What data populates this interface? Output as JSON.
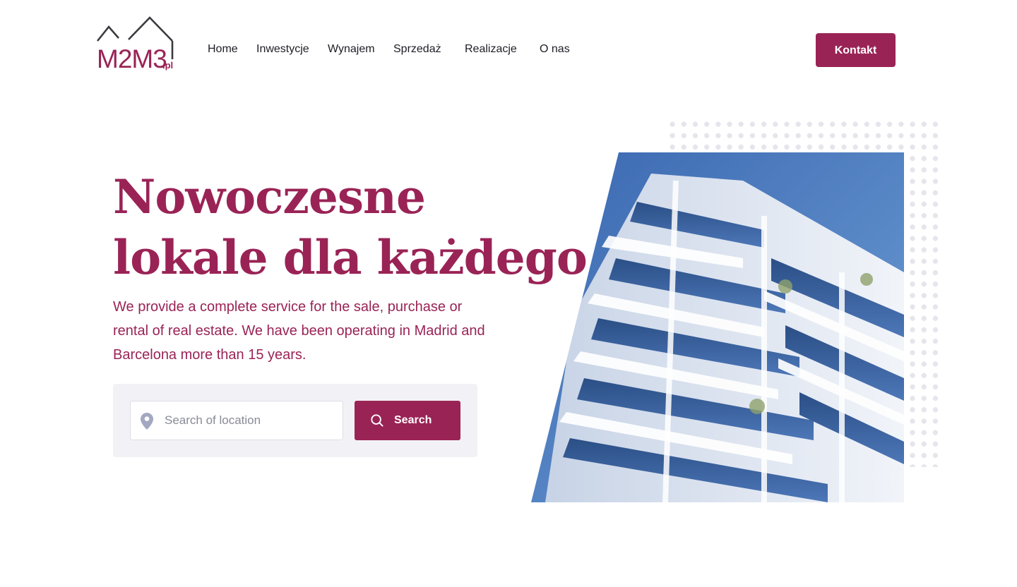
{
  "brand": {
    "logo_text": "M2M3",
    "logo_suffix": ".pl",
    "accent_color": "#9a2356"
  },
  "nav": {
    "items": [
      {
        "label": "Home"
      },
      {
        "label": "Inwestycje"
      },
      {
        "label": "Wynajem"
      },
      {
        "label": "Sprzedaż"
      },
      {
        "label": "Realizacje"
      },
      {
        "label": "O nas"
      }
    ],
    "contact_label": "Kontakt"
  },
  "hero": {
    "title_line1": "Nowoczesne",
    "title_line2": "lokale dla każdego",
    "description": "We provide a complete service for the sale, purchase or rental of real estate. We have been operating in Madrid and Barcelona more than 15 years."
  },
  "search": {
    "placeholder": "Search of location",
    "value": "",
    "button_label": "Search",
    "input_icon": "location-pin-icon",
    "button_icon": "search-icon"
  },
  "image": {
    "subject": "modern-apartment-building-photo"
  }
}
